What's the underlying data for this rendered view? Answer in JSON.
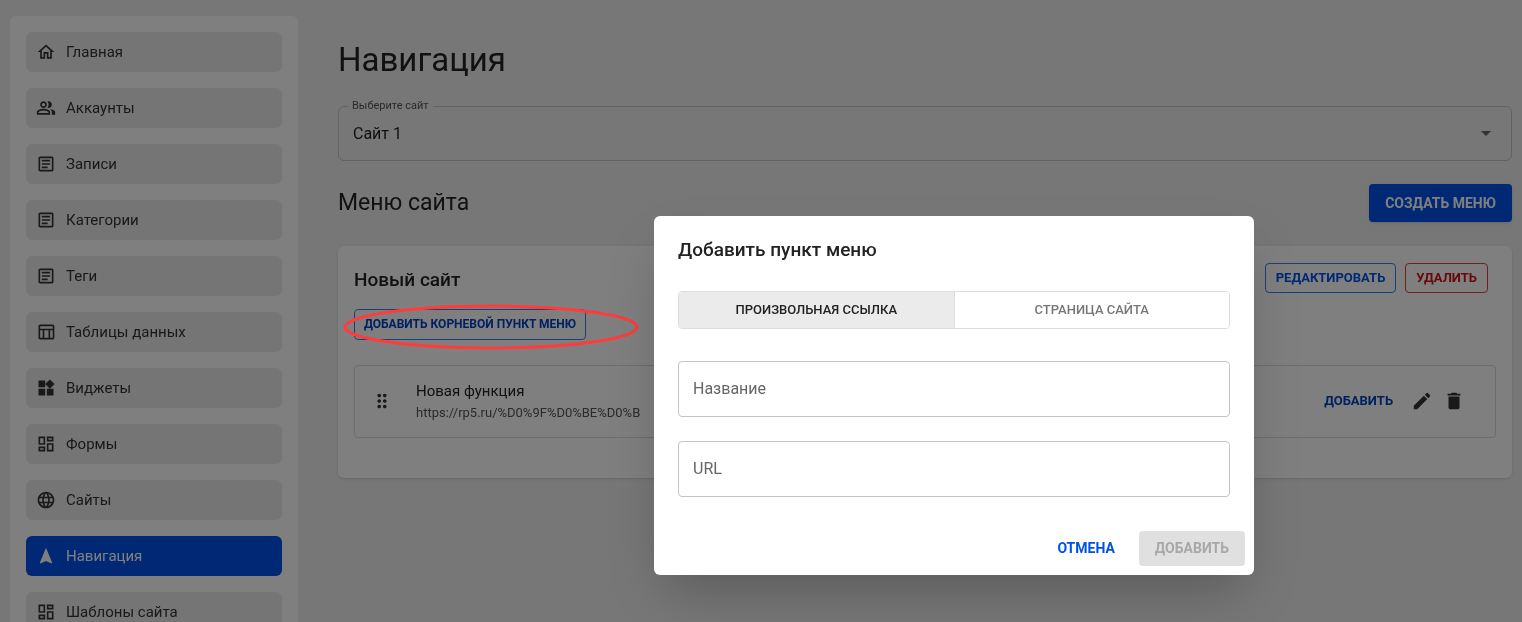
{
  "sidebar": {
    "items": [
      {
        "label": "Главная",
        "selected": false
      },
      {
        "label": "Аккаунты",
        "selected": false
      },
      {
        "label": "Записи",
        "selected": false
      },
      {
        "label": "Категории",
        "selected": false
      },
      {
        "label": "Теги",
        "selected": false
      },
      {
        "label": "Таблицы данных",
        "selected": false
      },
      {
        "label": "Виджеты",
        "selected": false
      },
      {
        "label": "Формы",
        "selected": false
      },
      {
        "label": "Сайты",
        "selected": false
      },
      {
        "label": "Навигация",
        "selected": true
      },
      {
        "label": "Шаблоны сайта",
        "selected": false
      }
    ]
  },
  "page": {
    "title": "Навигация",
    "site_select": {
      "label": "Выберите сайт",
      "value": "Сайт 1"
    },
    "section_title": "Меню сайта",
    "create_button": "СОЗДАТЬ МЕНЮ",
    "card": {
      "title": "Новый сайт",
      "edit_button": "РЕДАКТИРОВАТЬ",
      "delete_button": "УДАЛИТЬ",
      "add_root_button": "ДОБАВИТЬ КОРНЕВОЙ ПУНКТ МЕНЮ",
      "items": [
        {
          "title": "Новая функция",
          "url": "https://rp5.ru/%D0%9F%D0%BE%D0%B",
          "add_button": "ДОБАВИТЬ"
        }
      ]
    }
  },
  "dialog": {
    "title": "Добавить пункт меню",
    "tabs": [
      {
        "label": "ПРОИЗВОЛЬНАЯ ССЫЛКА",
        "selected": true
      },
      {
        "label": "СТРАНИЦА САЙТА",
        "selected": false
      }
    ],
    "fields": [
      {
        "placeholder": "Название"
      },
      {
        "placeholder": "URL"
      }
    ],
    "cancel_button": "ОТМЕНА",
    "submit_button": {
      "label": "ДОБАВИТЬ",
      "disabled": true
    }
  }
}
